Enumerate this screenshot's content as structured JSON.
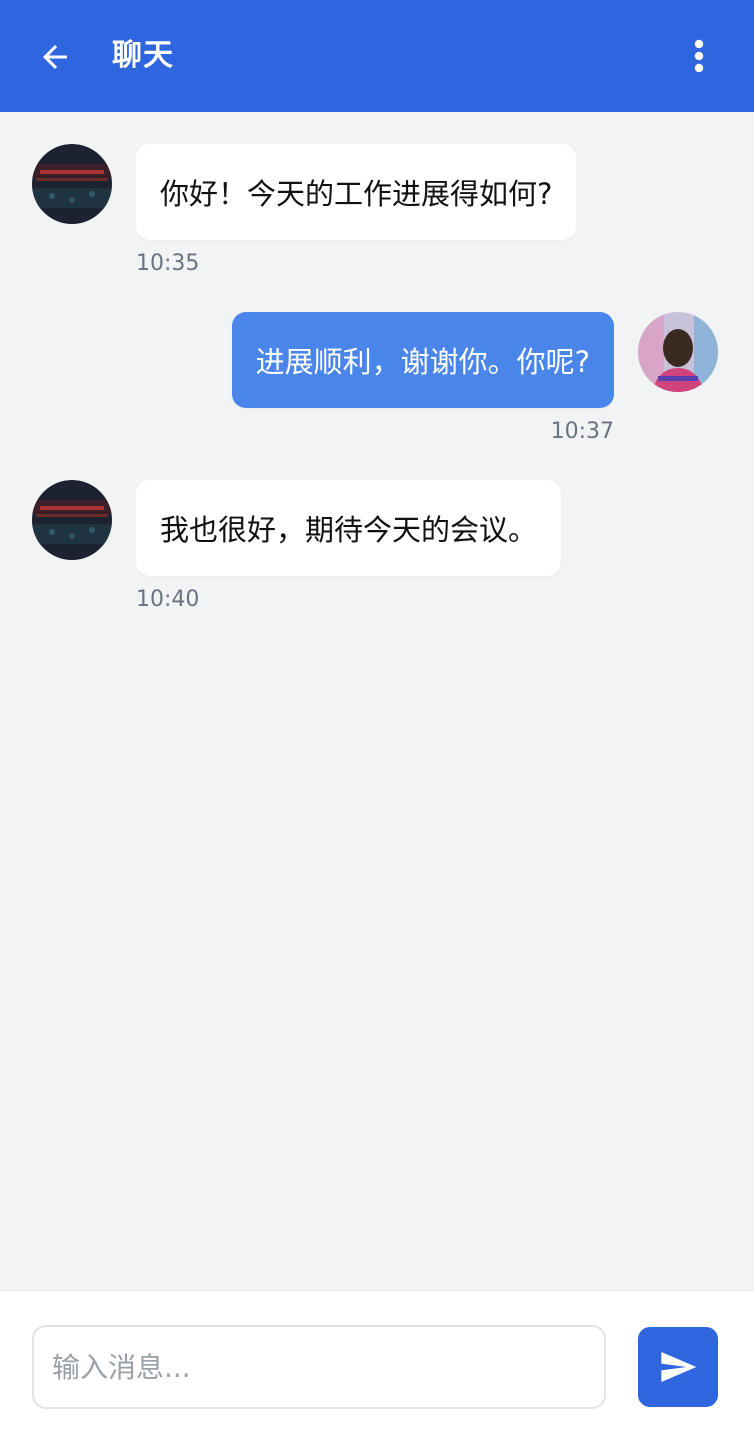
{
  "header": {
    "title": "聊天",
    "back_icon": "arrow-left-icon",
    "menu_icon": "more-vertical-icon",
    "color": "#2f66e0"
  },
  "messages": [
    {
      "direction": "incoming",
      "text": "你好！今天的工作进展得如何?",
      "time": "10:35",
      "avatar": "contact-avatar"
    },
    {
      "direction": "outgoing",
      "text": "进展顺利，谢谢你。你呢?",
      "time": "10:37",
      "avatar": "user-avatar"
    },
    {
      "direction": "incoming",
      "text": "我也很好，期待今天的会议。",
      "time": "10:40",
      "avatar": "contact-avatar"
    }
  ],
  "composer": {
    "placeholder": "输入消息...",
    "value": "",
    "send_icon": "send-icon"
  },
  "colors": {
    "background": "#f2f3f5",
    "incoming_bubble": "#ffffff",
    "outgoing_bubble": "#4a86ea",
    "accent": "#2f66e0"
  }
}
